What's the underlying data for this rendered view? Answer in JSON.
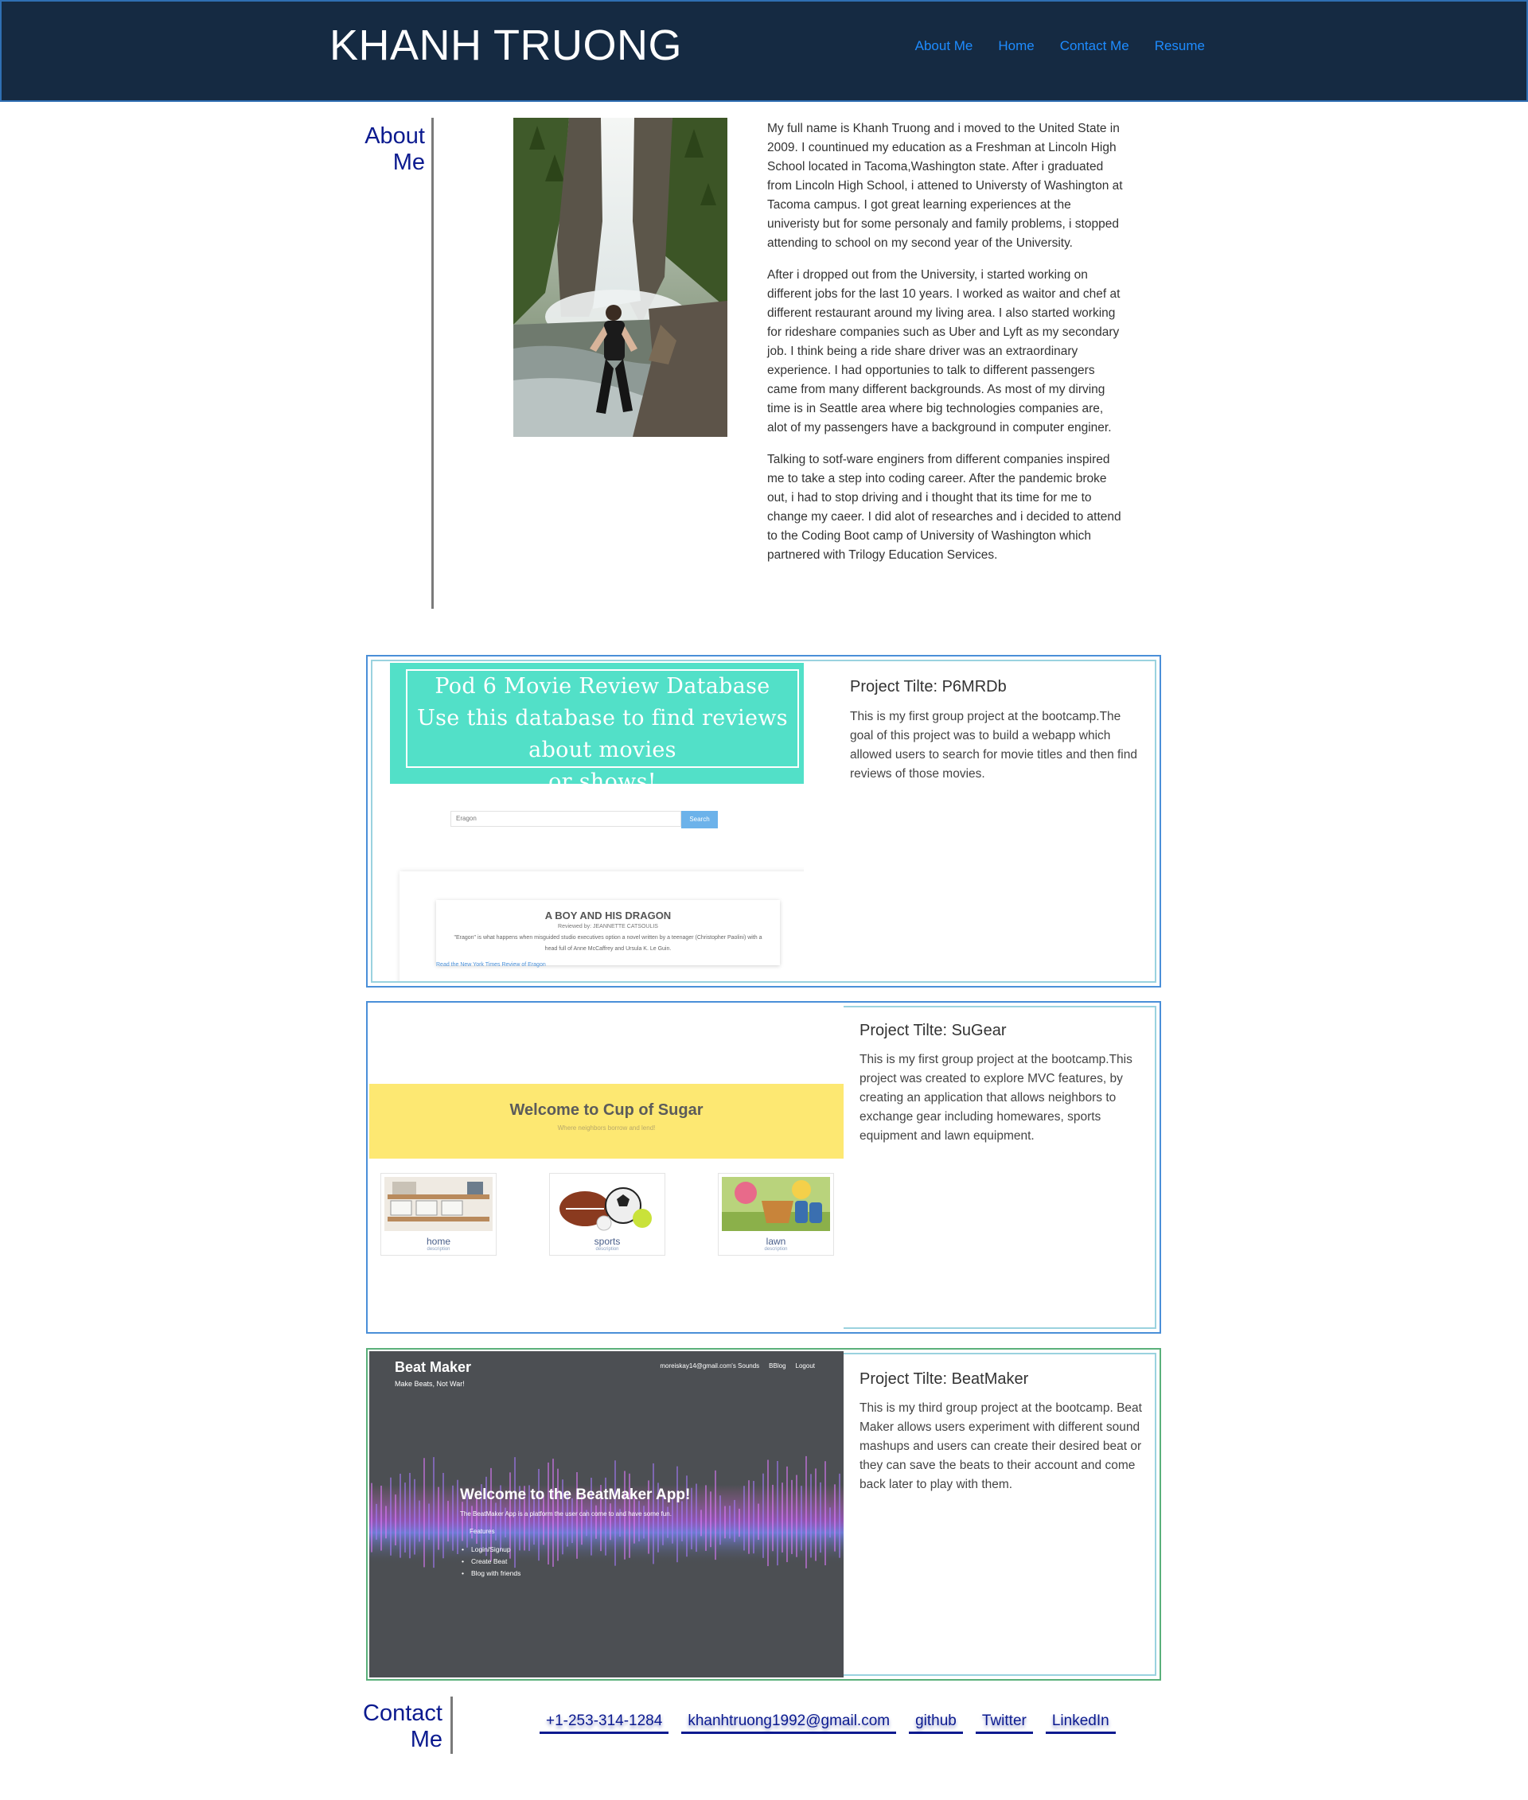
{
  "header": {
    "site_title": "KHANH TRUONG",
    "nav": [
      "About Me",
      "Home",
      "Contact Me",
      "Resume"
    ]
  },
  "about": {
    "heading_line1": "About",
    "heading_line2": "Me",
    "paragraphs": [
      "My full name is Khanh Truong and i moved to the United State in 2009. I countinued my education as a Freshman at Lincoln High School located in Tacoma,Washington state. After i graduated from Lincoln High School, i attened to Universty of Washington at Tacoma campus. I got great learning experiences at the univeristy but for some personaly and family problems, i stopped attending to school on my second year of the University.",
      "After i dropped out from the University, i started working on different jobs for the last 10 years. I worked as waitor and chef at different restaurant around my living area. I also started working for rideshare companies such as Uber and Lyft as my secondary job. I think being a ride share driver was an extraordinary experience. I had opportunies to talk to different passengers came from many different backgrounds. As most of my dirving time is in Seattle area where big technologies companies are, alot of my passengers have a background in computer enginer.",
      "Talking to sotf-ware enginers from different companies inspired me to take a step into coding career. After the pandemic broke out, i had to stop driving and i thought that its time for me to change my caeer. I did alot of researches and i decided to attend to the Coding Boot camp of University of Washington which partnered with Trilogy Education Services."
    ]
  },
  "projects": [
    {
      "title": "Project Tilte: P6MRDb",
      "description": "This is my first group project at the bootcamp.The goal of this project was to build a webapp which allowed users to search for movie titles and then find reviews of those movies.",
      "screenshot": {
        "banner_line1": "Pod 6 Movie Review Database",
        "banner_line2": "Use this database to find reviews about movies",
        "banner_line3": "or shows!",
        "search_value": "Eragon",
        "search_button": "Search",
        "review_title": "A BOY AND HIS DRAGON",
        "review_by": "Reviewed by: JEANNETTE CATSOULIS",
        "review_text": "\"Eragon\" is what happens when misguided studio executives option a novel written by a teenager (Christopher Paolini) with a head full of Anne McCaffrey and Ursula K. Le Guin.",
        "review_link": "Read the New York Times Review of Eragon"
      }
    },
    {
      "title": "Project Tilte: SuGear",
      "description": "This is my first group project at the bootcamp.This project was created to explore MVC features, by creating an application that allows neighbors to exchange gear including homewares, sports equipment and lawn equipment.",
      "screenshot": {
        "banner_title": "Welcome to Cup of Sugar",
        "banner_sub": "Where neighbors borrow and lend!",
        "tiles": [
          {
            "label": "home",
            "desc": "description"
          },
          {
            "label": "sports",
            "desc": "description"
          },
          {
            "label": "lawn",
            "desc": "description"
          }
        ]
      }
    },
    {
      "title": "Project Tilte: BeatMaker",
      "description": "This is my third group project at the bootcamp. Beat Maker allows users experiment with different sound mashups and users can create their desired beat or they can save the beats to their account and come back later to play with them.",
      "screenshot": {
        "app_title": "Beat Maker",
        "tagline": "Make Beats, Not War!",
        "nav": [
          "moreiskay14@gmail.com's Sounds",
          "BBlog",
          "Logout"
        ],
        "welcome": "Welcome to the BeatMaker App!",
        "intro": "The BeatMaker App is a platform the user can come to and have some fun.",
        "features_label": "Features",
        "features": [
          "Login/Signup",
          "Create Beat",
          "Blog with friends"
        ]
      }
    }
  ],
  "contact": {
    "heading_line1": "Contact",
    "heading_line2": "Me",
    "links": [
      "+1-253-314-1284",
      "khanhtruong1992@gmail.com",
      "github",
      "Twitter",
      "LinkedIn"
    ]
  },
  "colors": {
    "header_bg": "#152a42",
    "nav_link": "#1e8cff",
    "heading": "#0b1a8f",
    "card_border": "#4a8fd8",
    "banner_teal": "#52e0c8",
    "banner_yellow": "#fde872"
  }
}
